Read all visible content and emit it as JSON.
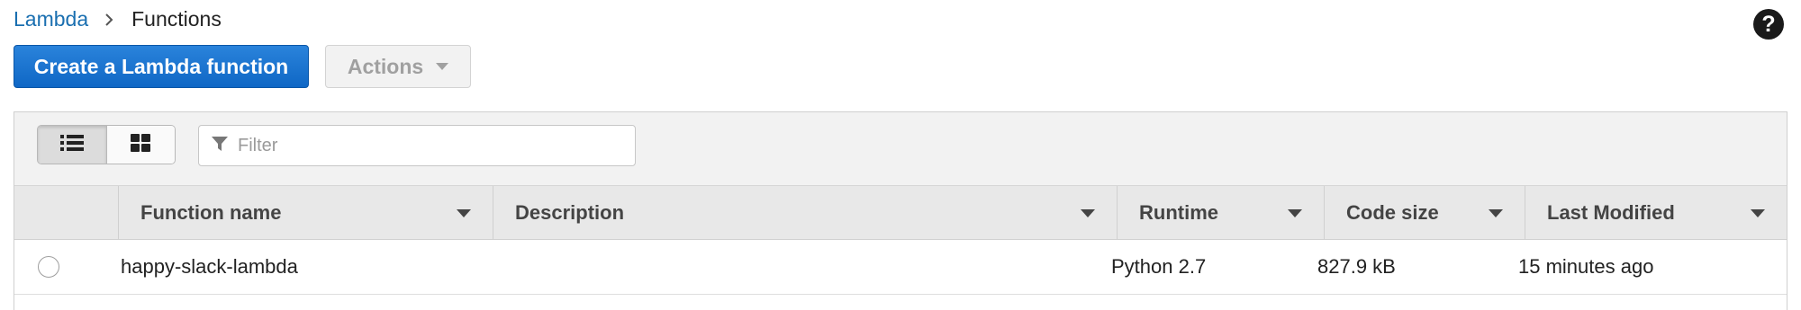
{
  "breadcrumb": {
    "root": "Lambda",
    "current": "Functions"
  },
  "help": {
    "label": "?"
  },
  "toolbar": {
    "create_label": "Create a Lambda function",
    "actions_label": "Actions"
  },
  "filter": {
    "placeholder": "Filter",
    "value": ""
  },
  "view_modes": [
    {
      "name": "list-view",
      "icon": "list-icon",
      "active": true
    },
    {
      "name": "card-view",
      "icon": "grid-icon",
      "active": false
    }
  ],
  "table": {
    "columns": [
      "Function name",
      "Description",
      "Runtime",
      "Code size",
      "Last Modified"
    ],
    "rows": [
      {
        "function_name": "happy-slack-lambda",
        "description": "",
        "runtime": "Python 2.7",
        "code_size": "827.9 kB",
        "last_modified": "15 minutes ago"
      }
    ]
  },
  "colors": {
    "primary_button": "#1a73d1",
    "link": "#1a6fb0",
    "toolbar_bg": "#f2f2f2",
    "header_bg": "#e8e8e8"
  }
}
